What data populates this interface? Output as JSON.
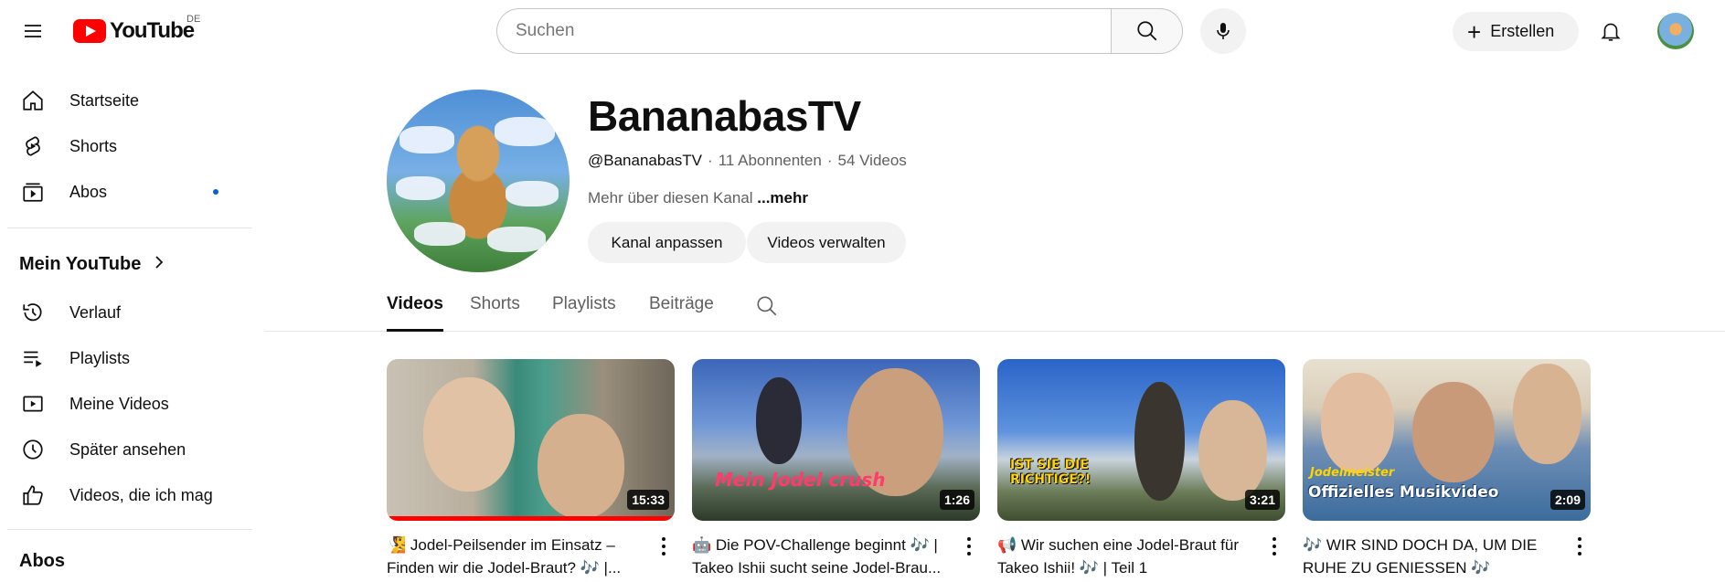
{
  "topbar": {
    "logo_text": "YouTube",
    "region": "DE",
    "search_placeholder": "Suchen",
    "create_label": "Erstellen"
  },
  "sidebar": {
    "primary": [
      {
        "label": "Startseite",
        "icon": "home-icon"
      },
      {
        "label": "Shorts",
        "icon": "shorts-icon"
      },
      {
        "label": "Abos",
        "icon": "subscriptions-icon",
        "has_dot": true
      }
    ],
    "you_title": "Mein YouTube",
    "you_items": [
      {
        "label": "Verlauf",
        "icon": "history-icon"
      },
      {
        "label": "Playlists",
        "icon": "playlists-icon"
      },
      {
        "label": "Meine Videos",
        "icon": "my-videos-icon"
      },
      {
        "label": "Später ansehen",
        "icon": "watch-later-icon"
      },
      {
        "label": "Videos, die ich mag",
        "icon": "liked-icon"
      }
    ],
    "subs_title": "Abos"
  },
  "channel": {
    "name": "BananabasTV",
    "handle": "@BananabasTV",
    "subscribers": "11 Abonnenten",
    "videos": "54 Videos",
    "description": "Mehr über diesen Kanal",
    "more": "...mehr",
    "btn_customize": "Kanal anpassen",
    "btn_manage": "Videos verwalten"
  },
  "tabs": [
    "Videos",
    "Shorts",
    "Playlists",
    "Beiträge"
  ],
  "videos": [
    {
      "title": "🧏 Jodel-Peilsender im Einsatz – Finden wir die Jodel-Braut? 🎶 |...",
      "duration": "15:33",
      "progress": 1.0
    },
    {
      "title": "🤖 Die POV-Challenge beginnt 🎶 | Takeo Ishii sucht seine Jodel-Brau...",
      "duration": "1:26",
      "progress": 0.0,
      "overlay": "Mein Jodel crush"
    },
    {
      "title": "📢 Wir suchen eine Jodel-Braut für Takeo Ishii! 🎶 | Teil 1",
      "duration": "3:21",
      "progress": 0.0,
      "overlay": "IST SIE DIE RICHTIGE?!"
    },
    {
      "title": "🎶 WIR SIND DOCH DA, UM DIE RUHE ZU GENIESSEN 🎶",
      "duration": "2:09",
      "progress": 0.0,
      "overlay_top": "Jodelmeister",
      "overlay": "Offizielles Musikvideo"
    }
  ],
  "colors": {
    "brand_red": "#ff0000",
    "accent_blue": "#065fd4",
    "chip_bg": "#f2f2f2"
  }
}
